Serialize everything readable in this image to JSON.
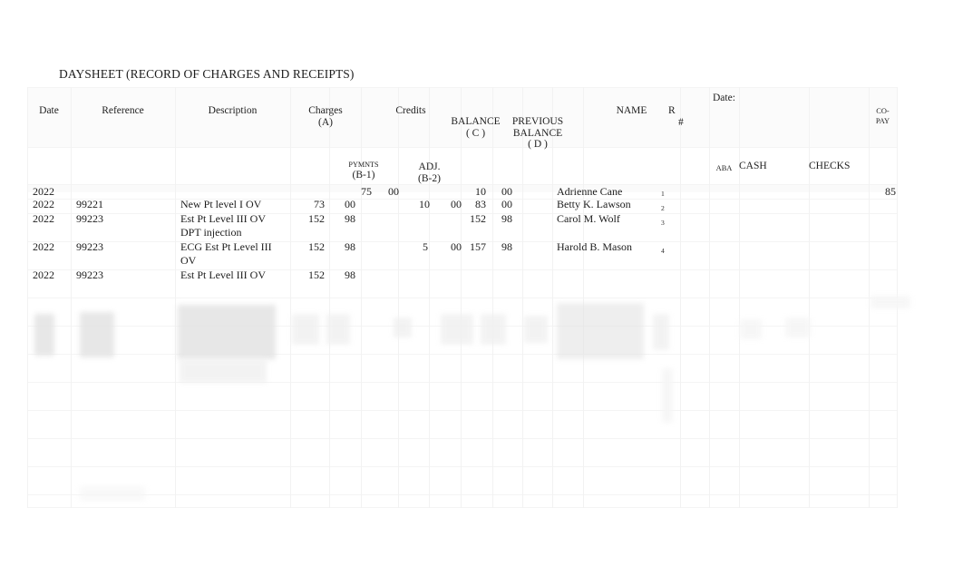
{
  "document": {
    "title": "DAYSHEET (RECORD OF CHARGES AND RECEIPTS)",
    "date_label": "Date:"
  },
  "table": {
    "headers": {
      "date": "Date",
      "reference": "Reference",
      "description": "Description",
      "charges_line1": "Charges",
      "charges_line2": "(A)",
      "credits": "Credits",
      "pymnts_line1": "PYMNTS",
      "pymnts_line2": "(B-1)",
      "adj_line1": "ADJ.",
      "adj_line2": "(B-2)",
      "balance_line1": "BALANCE",
      "balance_line2": "( C )",
      "previous_balance_line1": "PREVIOUS",
      "previous_balance_line2": "BALANCE",
      "previous_balance_line3": "( D )",
      "name": "NAME",
      "r_line1": "R",
      "r_line2": "#",
      "aba": "ABA",
      "cash": "CASH",
      "checks": "CHECKS",
      "copay_line1": "CO-",
      "copay_line2": "PAY"
    },
    "rows": [
      {
        "date": "2022",
        "reference": "",
        "description": "",
        "charges_dollars": "",
        "charges_cents": "",
        "pymnts_dollars": "75",
        "pymnts_cents": "00",
        "adj_dollars": "",
        "adj_cents": "",
        "balance_dollars": "10",
        "balance_cents": "00",
        "previous_balance_dollars": "",
        "previous_balance_cents": "",
        "name": "Adrienne Cane",
        "r_number": "1",
        "aba": "",
        "cash": "",
        "checks": "",
        "copay": "85"
      },
      {
        "date": "2022",
        "reference": "99221",
        "description": "New Pt level I OV",
        "charges_dollars": "73",
        "charges_cents": "00",
        "pymnts_dollars": "",
        "pymnts_cents": "",
        "adj_dollars": "10",
        "adj_cents": "00",
        "balance_dollars": "83",
        "balance_cents": "00",
        "previous_balance_dollars": "",
        "previous_balance_cents": "",
        "name": "Betty K. Lawson",
        "r_number": "2",
        "aba": "",
        "cash": "",
        "checks": "",
        "copay": ""
      },
      {
        "date": "2022",
        "reference": "99223",
        "description": "Est Pt Level III OV\nDPT injection",
        "charges_dollars": "152",
        "charges_cents": "98",
        "pymnts_dollars": "",
        "pymnts_cents": "",
        "adj_dollars": "",
        "adj_cents": "",
        "balance_dollars": "152",
        "balance_cents": "98",
        "previous_balance_dollars": "",
        "previous_balance_cents": "",
        "name": "Carol M. Wolf",
        "r_number": "3",
        "aba": "",
        "cash": "",
        "checks": "",
        "copay": ""
      },
      {
        "date": "2022",
        "reference": "99223",
        "description": "ECG Est Pt Level III\nOV",
        "charges_dollars": "152",
        "charges_cents": "98",
        "pymnts_dollars": "",
        "pymnts_cents": "",
        "adj_dollars": "5",
        "adj_cents": "00",
        "balance_dollars": "157",
        "balance_cents": "98",
        "previous_balance_dollars": "",
        "previous_balance_cents": "",
        "name": "Harold B. Mason",
        "r_number": "4",
        "aba": "",
        "cash": "",
        "checks": "",
        "copay": ""
      },
      {
        "date": "2022",
        "reference": "99223",
        "description": "Est Pt Level III OV",
        "charges_dollars": "152",
        "charges_cents": "98",
        "pymnts_dollars": "",
        "pymnts_cents": "",
        "adj_dollars": "",
        "adj_cents": "",
        "balance_dollars": "",
        "balance_cents": "",
        "previous_balance_dollars": "",
        "previous_balance_cents": "",
        "name": "",
        "r_number": "",
        "aba": "",
        "cash": "",
        "checks": "",
        "copay": ""
      }
    ]
  }
}
